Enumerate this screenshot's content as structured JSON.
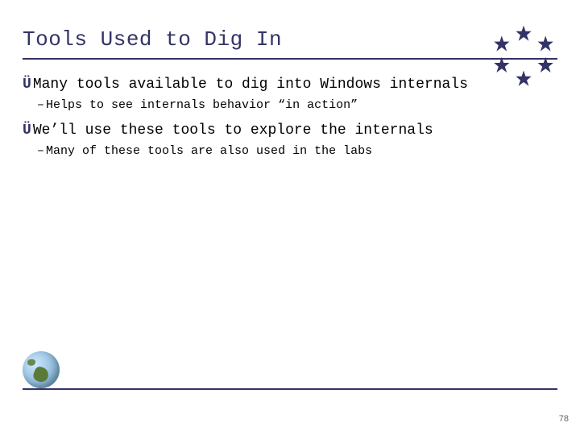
{
  "title": "Tools Used to Dig In",
  "bullets": {
    "b1a": "Many tools available to dig into Windows internals",
    "b2a": "Helps to see internals behavior “in action”",
    "b1b": "We’ll use these tools to explore the internals",
    "b2b": "Many of these tools are also used in the labs"
  },
  "glyphs": {
    "arrow": "Ü",
    "dash": "–"
  },
  "page_number": "78",
  "colors": {
    "accent": "#333366"
  }
}
